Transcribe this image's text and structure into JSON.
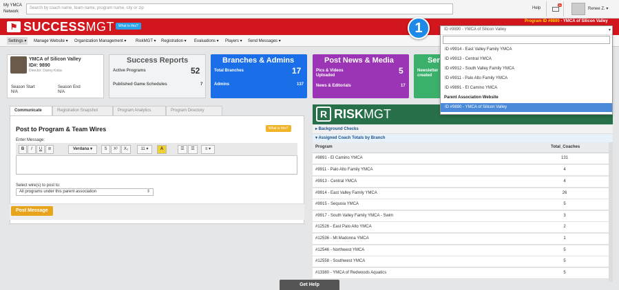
{
  "topbar": {
    "network_line1": "My YMCA",
    "network_line2": "Network",
    "search_placeholder": "Search by coach name, team name, program name, city or zip",
    "help": "Help",
    "mail_badge": "20",
    "user": "Renee Z. ▾"
  },
  "brand": {
    "logo_glyph": "⚑",
    "name_bold": "SUCCESS",
    "name_light": "MGT",
    "what_is_this": "What is this?",
    "program_id_label": "Program ID #9890",
    "program_id_name": " - YMCA of Silicon Valley",
    "colors": {
      "red": "#d2161d",
      "blue": "#2aa3e8",
      "yellow": "#e8a41a",
      "green": "#27704a"
    }
  },
  "menu": [
    {
      "label": "Settings ▾"
    },
    {
      "label": "Manage Website ▾"
    },
    {
      "label": "Organization Management ▾"
    },
    {
      "label": "RiskMGT ▾"
    },
    {
      "label": "Registration ▾"
    },
    {
      "label": "Evaluations ▾"
    },
    {
      "label": "Players ▾"
    },
    {
      "label": "Send Messages ▾"
    }
  ],
  "org_card": {
    "name": "YMCA of Silicon Valley",
    "id": "ID#: 9890",
    "director": "Director: Danny Koba",
    "season_start_label": "Season Start",
    "season_start_value": "N/A",
    "season_end_label": "Season End",
    "season_end_value": "N/A"
  },
  "success_reports": {
    "title": "Success Reports",
    "active_label": "Active Programs",
    "active_value": "52",
    "published_label": "Published Game Schedules",
    "published_value": "7"
  },
  "branches": {
    "title": "Branches & Admins",
    "total_label": "Total Branches",
    "total_value": "17",
    "admins_label": "Admins",
    "admins_value": "137"
  },
  "news": {
    "title": "Post News & Media",
    "pics_label1": "Pics & Videos",
    "pics_label2": "Uploaded",
    "pics_value": "5",
    "news_label": "News & Editorials",
    "news_value": "17"
  },
  "green_tile": {
    "title": "Ser",
    "label1": "Newsletter",
    "label2": "created"
  },
  "tabs": [
    {
      "label": "Communicate"
    },
    {
      "label": "Registration Snapshot"
    },
    {
      "label": "Program Analytics"
    },
    {
      "label": "Program Directory"
    }
  ],
  "post_panel": {
    "title": "Post to Program & Team Wires",
    "what_is_this": "What is this?",
    "enter_message": "Enter Message:",
    "toolbar": {
      "bold": "B",
      "italic": "I",
      "underline": "U",
      "eraser": "⊘",
      "font": "Verdana ▾",
      "strike": "S",
      "superscript": "X²",
      "subscript": "X₂",
      "size": "11 ▾",
      "color": "A",
      "ul": "☰",
      "ol": "☰",
      "align": "≡ ▾"
    },
    "select_label": "Select wire(s) to post to:",
    "select_value": "All programs under this parent association",
    "post_button": "Post Message"
  },
  "risk": {
    "mark": "R",
    "name_bold": "RISK",
    "name_light": "MGT",
    "background_checks": "▸ Background Checks",
    "assigned_totals": "▾ Assigned Coach Totals by Branch",
    "columns": [
      "Program",
      "Total_Coaches"
    ],
    "rows": [
      {
        "program": "#9891 - El Camino YMCA",
        "total": "131"
      },
      {
        "program": "#9911 - Palo Alto Family YMCA",
        "total": "4"
      },
      {
        "program": "#9913 - Central YMCA",
        "total": "4"
      },
      {
        "program": "#9914 - East Valley Family YMCA",
        "total": "26"
      },
      {
        "program": "#9915 - Sequoia YMCA",
        "total": "5"
      },
      {
        "program": "#9917 - South Valley Family YMCA - Swim",
        "total": "3"
      },
      {
        "program": "#12526 - East Palo Alto YMCA",
        "total": "2"
      },
      {
        "program": "#12536 - Mt Madonna YMCA",
        "total": "1"
      },
      {
        "program": "#12546 - Northwest YMCA",
        "total": "5"
      },
      {
        "program": "#12558 - Southwest YMCA",
        "total": "5"
      },
      {
        "program": "#13380 - YMCA of Redwoods Aquatics",
        "total": "5"
      }
    ]
  },
  "dropdown": {
    "current": "ID #9890 - YMCA of Silicon Valley",
    "items": [
      "ID #9914 - East Valley Family YMCA",
      "ID #9913 - Central YMCA",
      "ID #9912 - South Valley Family YMCA",
      "ID #9911 - Palo Alto Family YMCA",
      "ID #9891 - El Camino YMCA"
    ],
    "group_label": "Parent Association Website",
    "selected": "ID #9890 - YMCA of Silicon Valley"
  },
  "step_badge": "1",
  "get_help": "Get Help"
}
